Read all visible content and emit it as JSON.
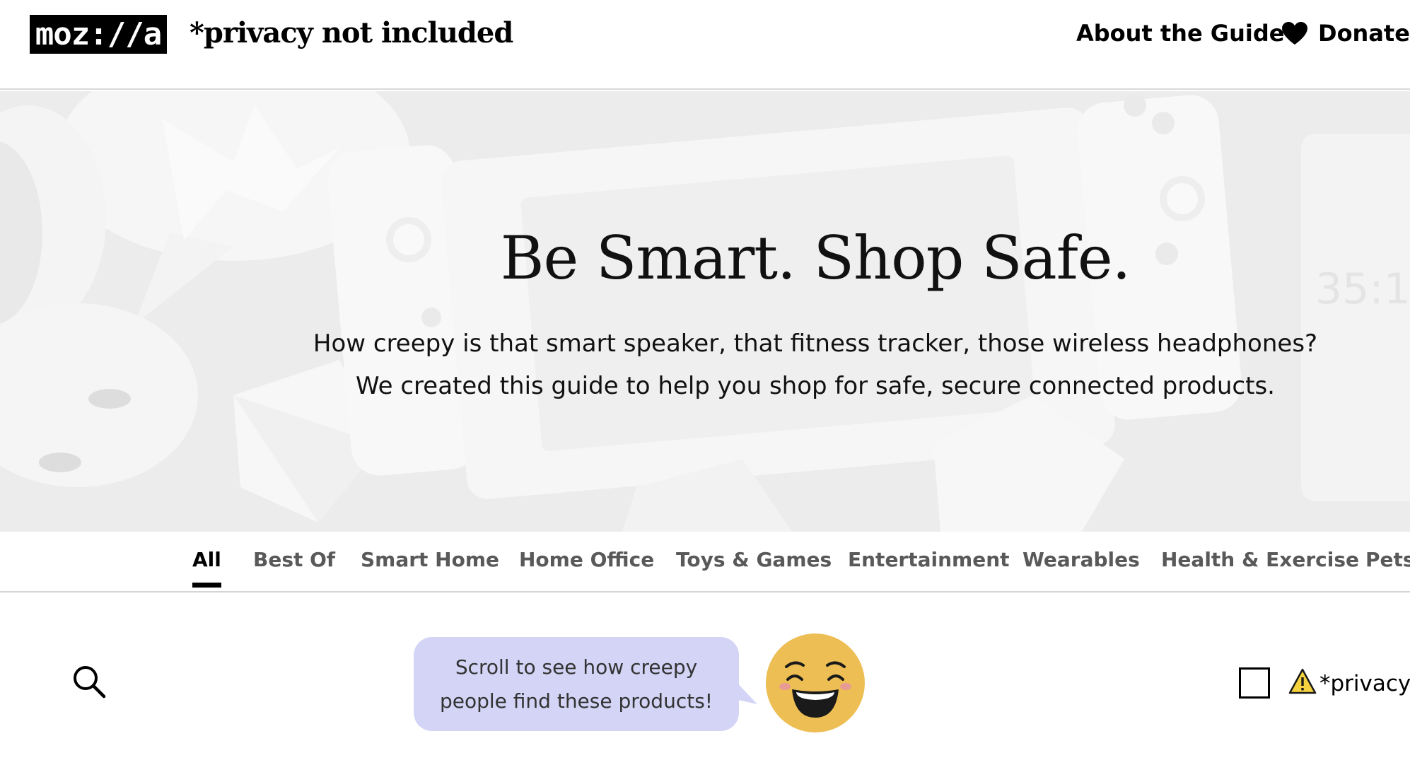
{
  "header": {
    "logo_text": "moz://a",
    "site_title": "*privacy not included",
    "about_label": "About the Guide",
    "donate_label": "Donate",
    "donate_icon": "heart-icon"
  },
  "hero": {
    "title": "Be Smart. Shop Safe.",
    "subtitle_line1": "How creepy is that smart speaker, that fitness tracker, those wireless headphones?",
    "subtitle_line2": "We created this guide to help you shop for safe, secure connected products."
  },
  "categories": {
    "items": [
      "All",
      "Best Of",
      "Smart Home",
      "Home Office",
      "Toys & Games",
      "Entertainment",
      "Wearables",
      "Health & Exercise",
      "Pets"
    ],
    "active": "All"
  },
  "toolbar": {
    "search_icon": "search-icon",
    "bubble_line1": "Scroll to see how creepy",
    "bubble_line2": "people find these products!",
    "emoji": "grinning-face-icon",
    "filter_label": "*privacy",
    "filter_checked": false,
    "warning_icon": "warning-icon"
  },
  "colors": {
    "bubble_bg": "#d3d4f6",
    "emoji_yellow": "#ecbe54",
    "warning_yellow": "#f5d33f",
    "hero_bg": "#ececec"
  }
}
